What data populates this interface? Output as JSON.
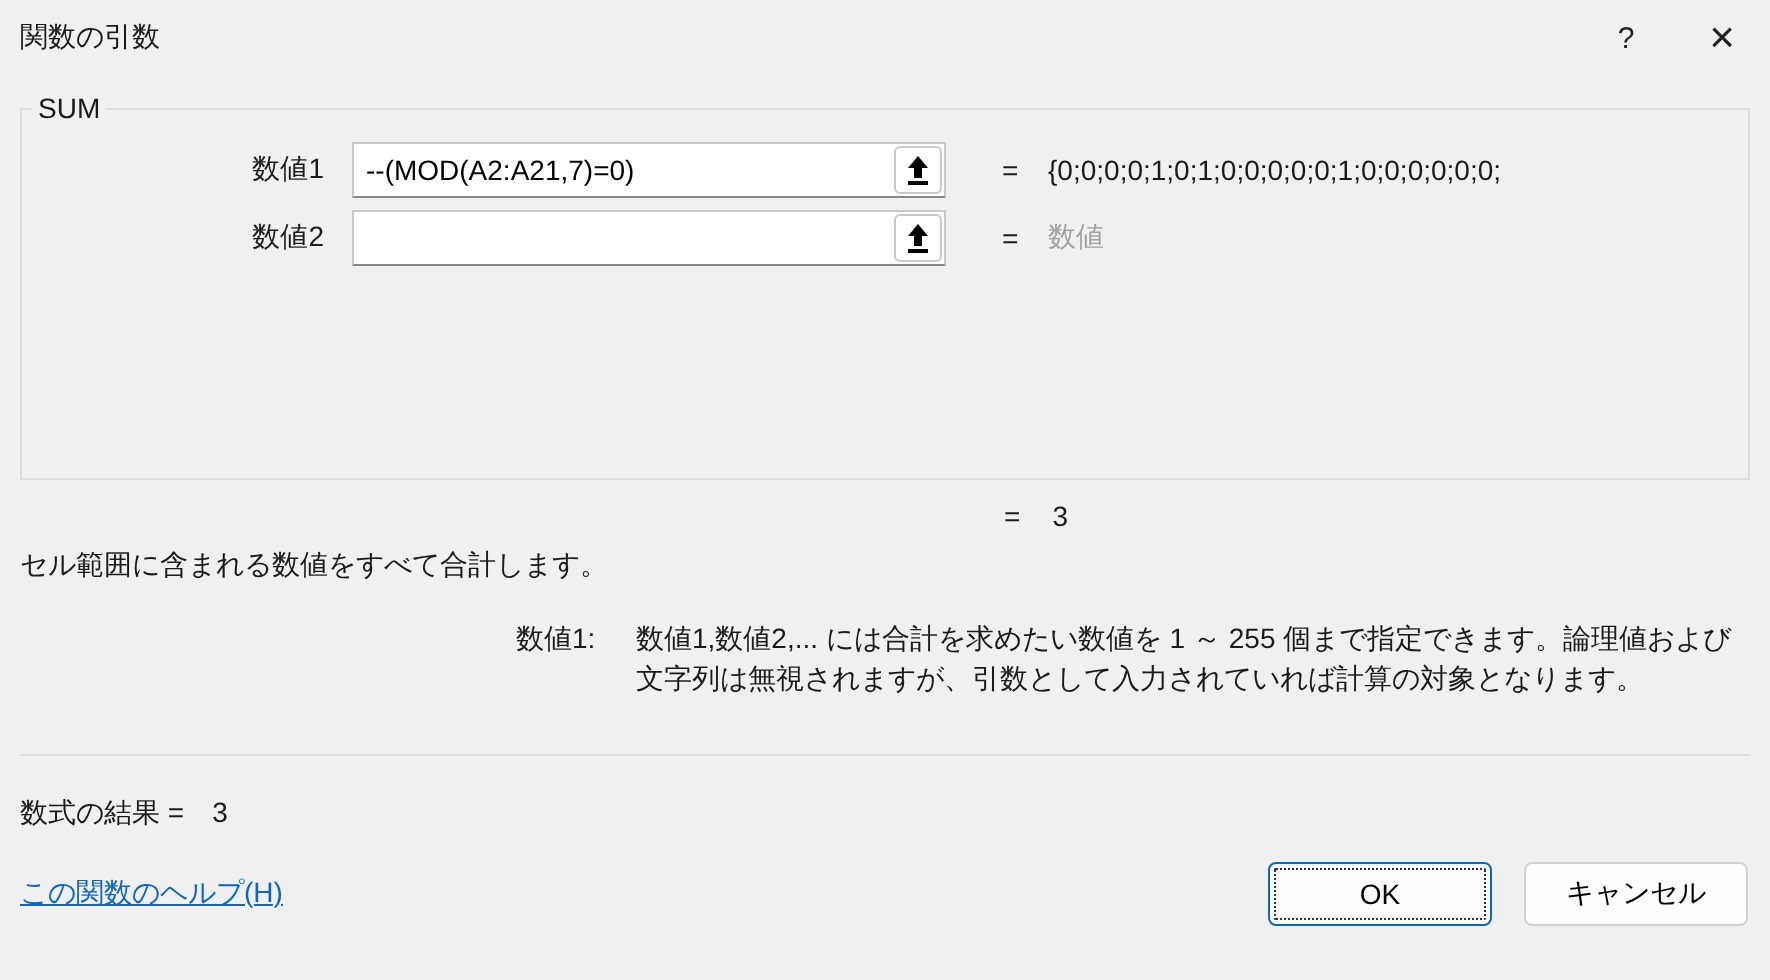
{
  "window": {
    "title": "関数の引数",
    "help": "?",
    "close": "×"
  },
  "function_group": {
    "name": "SUM",
    "arguments": [
      {
        "label": "数値1",
        "value": "--(MOD(A2:A21,7)=0)",
        "equals": "=",
        "result": "{0;0;0;0;1;0;1;0;0;0;0;0;1;0;0;0;0;0;0;",
        "result_dimmed": false
      },
      {
        "label": "数値2",
        "equals": "=",
        "result": "数値",
        "result_dimmed": true
      }
    ]
  },
  "function_result": {
    "equals": "=",
    "value": "3"
  },
  "description": "セル範囲に含まれる数値をすべて合計します。",
  "argument_help": {
    "label": "数値1:",
    "text": "数値1,数値2,... には合計を求めたい数値を 1 ～ 255 個まで指定できます。論理値および文字列は無視されますが、引数として入力されていれば計算の対象となります。"
  },
  "formula_result": {
    "label": "数式の結果 =",
    "value": "3"
  },
  "help_link": "この関数のヘルプ(H)",
  "buttons": [
    {
      "label": "OK",
      "default": true
    },
    {
      "label": "キャンセル",
      "default": false
    }
  ]
}
